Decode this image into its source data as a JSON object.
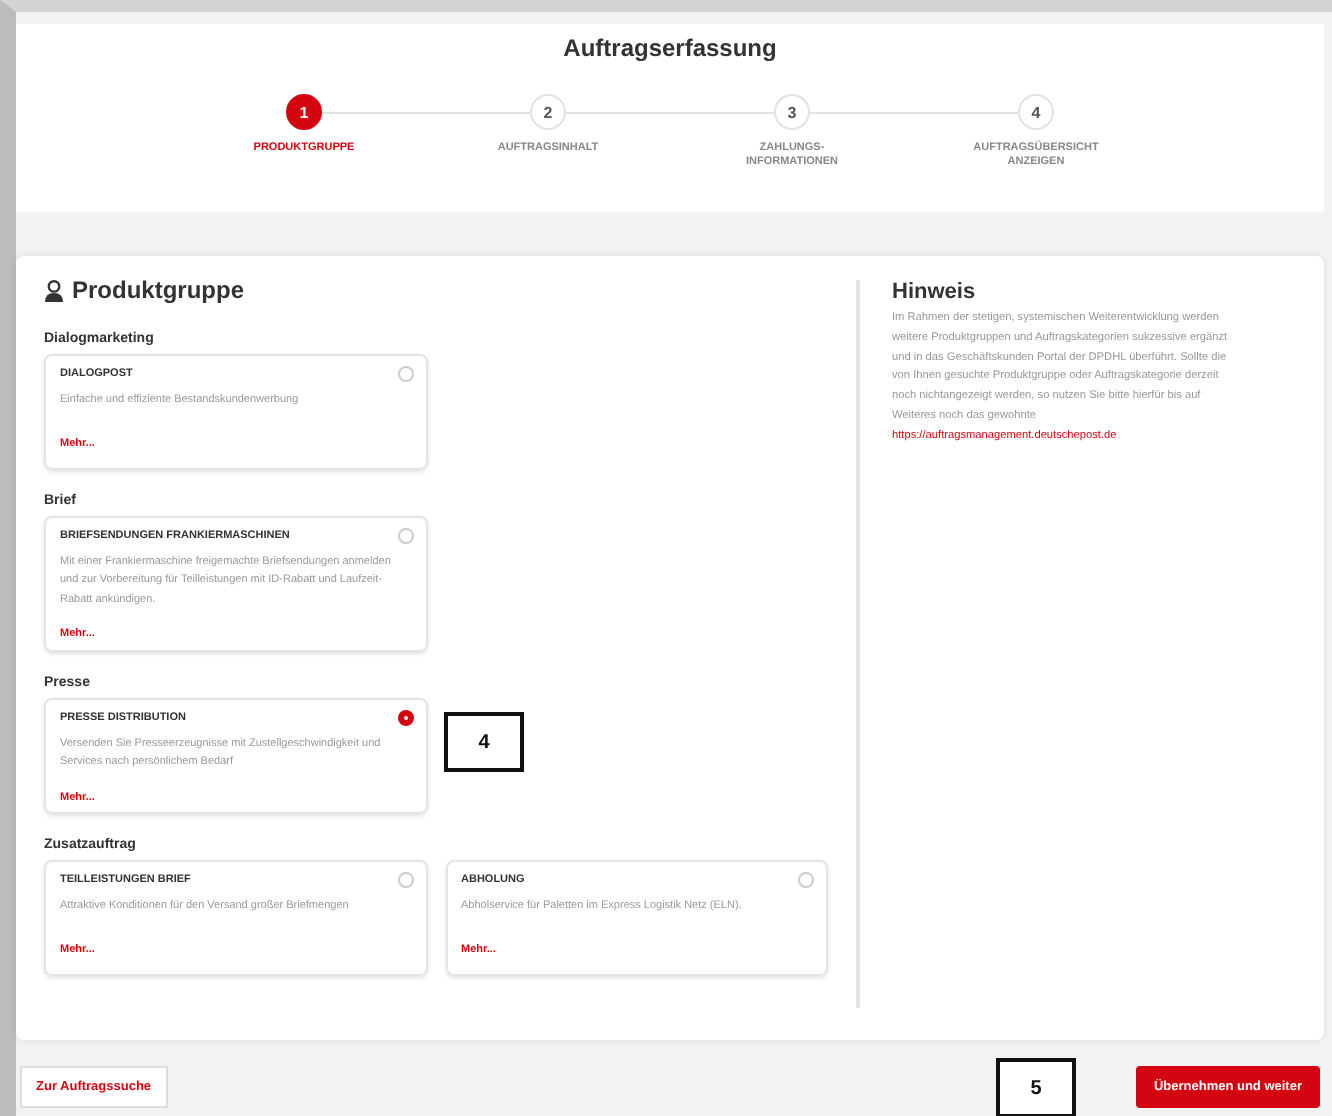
{
  "title": "Auftragserfassung",
  "steps": [
    {
      "number": "1",
      "label": "PRODUKTGRUPPE",
      "selected": true
    },
    {
      "number": "2",
      "label": "AUFTRAGSINHALT",
      "selected": false
    },
    {
      "number": "3",
      "label": "ZAHLUNGS-\nINFORMATIONEN",
      "selected": false
    },
    {
      "number": "4",
      "label": "AUFTRAGSÜBERSICHT\nANZEIGEN",
      "selected": false
    }
  ],
  "heading": "Produktgruppe",
  "groups": [
    {
      "label": "Dialogmarketing",
      "options": [
        {
          "title": "DIALOGPOST",
          "description": "Einfache und effiziente Bestandskundenwerbung",
          "more": "Mehr...",
          "selected": false
        }
      ]
    },
    {
      "label": "Brief",
      "options": [
        {
          "title": "BRIEFSENDUNGEN FRANKIERMASCHINEN",
          "description": "Mit einer Frankiermaschine freigemachte Briefsendungen anmelden und zur Vorbereitung für Teilleistungen mit ID-Rabatt und Laufzeit-Rabatt ankündigen.",
          "more": "Mehr...",
          "selected": false
        }
      ]
    },
    {
      "label": "Presse",
      "options": [
        {
          "title": "PRESSE DISTRIBUTION",
          "description": "Versenden Sie Presseerzeugnisse mit Zustellgeschwindigkeit und Services nach persönlichem Bedarf",
          "more": "Mehr...",
          "selected": true
        }
      ],
      "callout": "4"
    },
    {
      "label": "Zusatzauftrag",
      "options": [
        {
          "title": "TEILLEISTUNGEN BRIEF",
          "description": "Attraktive Konditionen für den Versand großer Briefmengen",
          "more": "Mehr...",
          "selected": false
        },
        {
          "title": "ABHOLUNG",
          "description": "Abholservice für Paletten im Express Logistik Netz (ELN).",
          "more": "Mehr...",
          "selected": false
        }
      ]
    }
  ],
  "hint": {
    "title": "Hinweis",
    "text": "Im Rahmen der stetigen, systemischen Weiterentwicklung werden weitere Produktgruppen und Auftragskategorien sukzessive ergänzt und in das Geschäftskunden Portal der DPDHL überführt. Sollte die von Ihnen gesuchte Produktgruppe oder Auftragskategorie derzeit noch nichtangezeigt werden, so nutzen Sie bitte hierfür bis auf Weiteres noch das gewohnte",
    "link": "https://auftragsmanagement.deutschepost.de"
  },
  "buttons": {
    "back": "Zur Auftragssuche",
    "callout": "5",
    "next": "Übernehmen und weiter"
  }
}
